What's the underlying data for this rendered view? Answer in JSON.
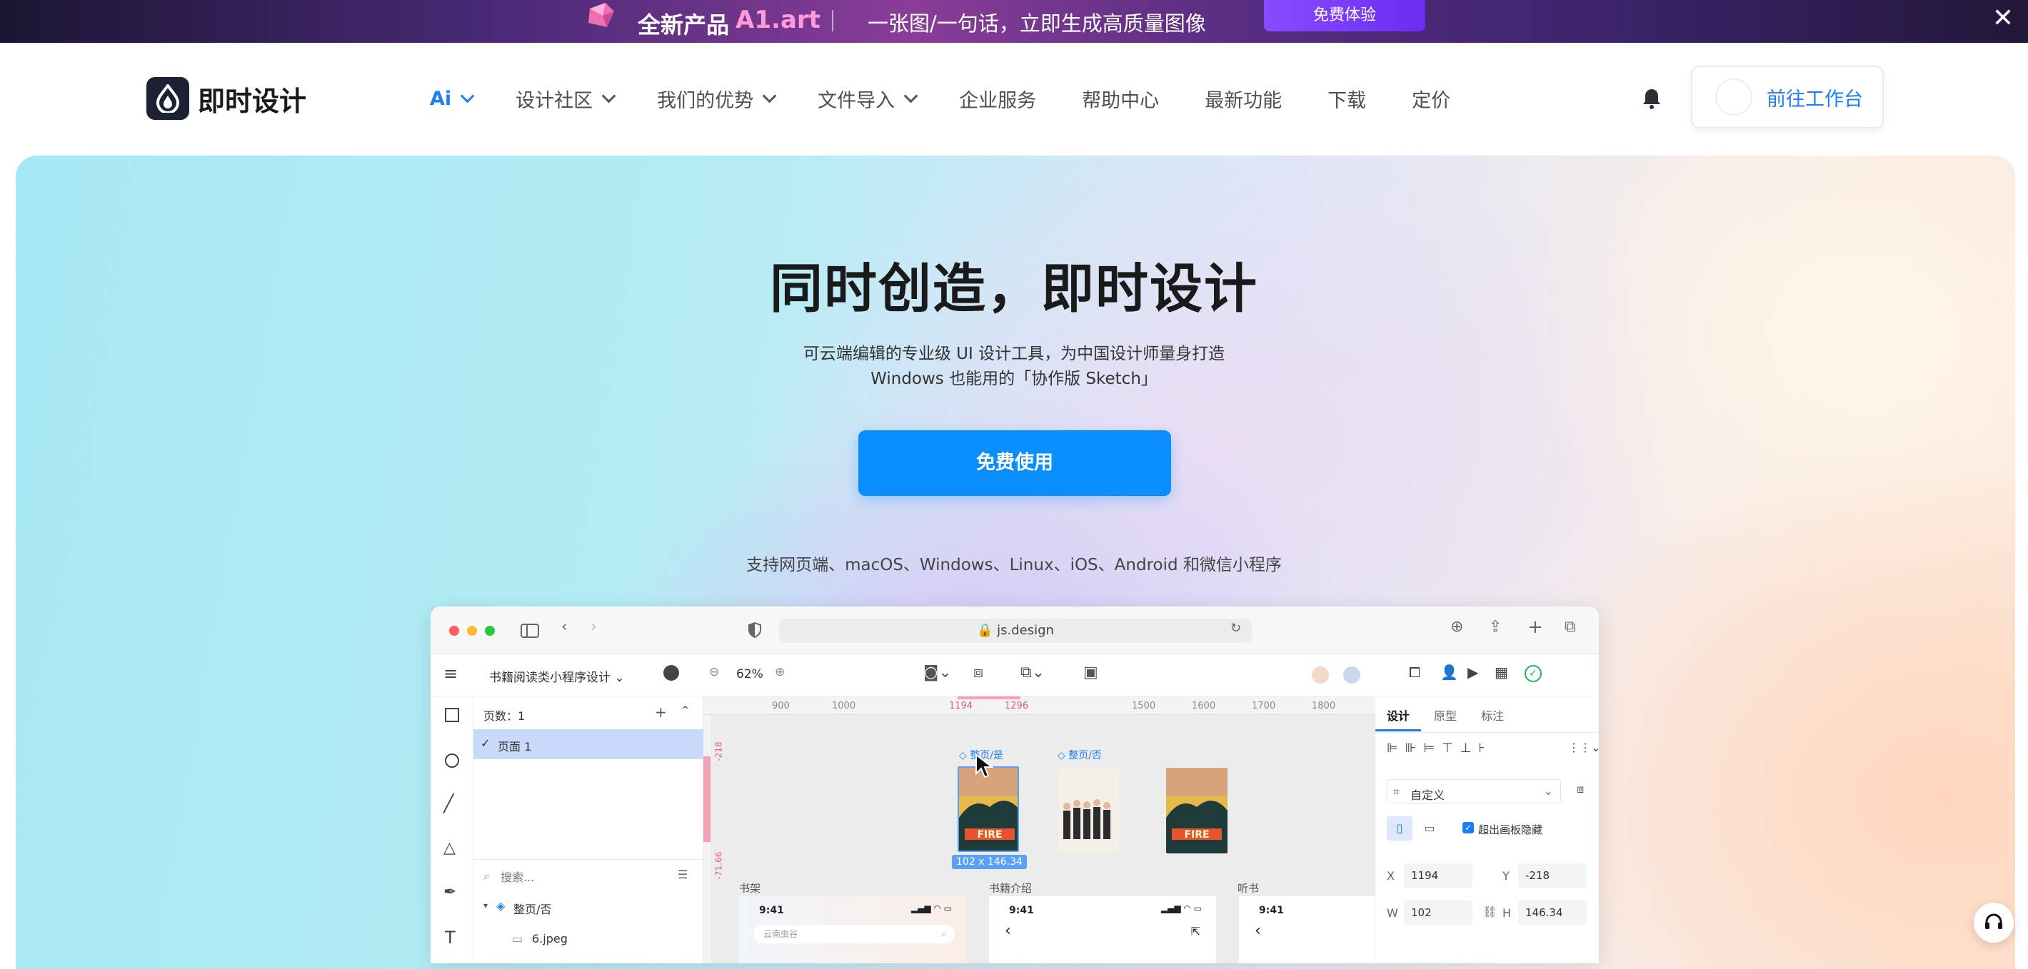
{
  "promo": {
    "product": "全新产品",
    "brand": "A1.art",
    "slogan": "一张图/一句话，立即生成高质量图像",
    "button": "免费体验",
    "close": "✕"
  },
  "nav": {
    "logo": "即时设计",
    "items": [
      {
        "label": "Ai",
        "dropdown": true
      },
      {
        "label": "设计社区",
        "dropdown": true
      },
      {
        "label": "我们的优势",
        "dropdown": true
      },
      {
        "label": "文件导入",
        "dropdown": true
      },
      {
        "label": "企业服务",
        "dropdown": false
      },
      {
        "label": "帮助中心",
        "dropdown": false
      },
      {
        "label": "最新功能",
        "dropdown": false
      },
      {
        "label": "下载",
        "dropdown": false
      },
      {
        "label": "定价",
        "dropdown": false
      }
    ],
    "workspace_button": "前往工作台"
  },
  "hero": {
    "title": "同时创造，即时设计",
    "subtitle_line1": "可云端编辑的专业级 UI 设计工具，为中国设计师量身打造",
    "subtitle_line2": "Windows 也能用的「协作版 Sketch」",
    "cta": "免费使用",
    "platforms": "支持网页端、macOS、Windows、Linux、iOS、Android 和微信小程序"
  },
  "app": {
    "url": "js.design",
    "file_name": "书籍阅读类小程序设计",
    "zoom": "62%",
    "pages_label": "页数：1",
    "page_item": "页面 1",
    "search_placeholder": "搜索...",
    "layer1": "整页/否",
    "layer2": "6.jpeg",
    "ruler_ticks": [
      "900",
      "1000",
      "1194",
      "1296",
      "1500",
      "1600",
      "1700",
      "1800"
    ],
    "vruler": [
      "-218",
      "-71.66"
    ],
    "frame_labels": [
      "整页/是",
      "整页/否"
    ],
    "size_label": "102 x 146.34",
    "section_labels": [
      "书架",
      "书籍介绍",
      "听书"
    ],
    "phone_time": "9:41",
    "phone_search": "云南虫谷",
    "right_tabs": [
      "设计",
      "原型",
      "标注"
    ],
    "frame_type": "自定义",
    "clip_label": "超出画板隐藏",
    "x": "1194",
    "y": "-218",
    "w": "102",
    "h": "146.34",
    "x_label": "X",
    "y_label": "Y",
    "w_label": "W",
    "h_label": "H"
  },
  "colors": {
    "accent": "#0a8efc",
    "brand_dark": "#1c2233",
    "promo_pink": "#ff9bd7"
  }
}
